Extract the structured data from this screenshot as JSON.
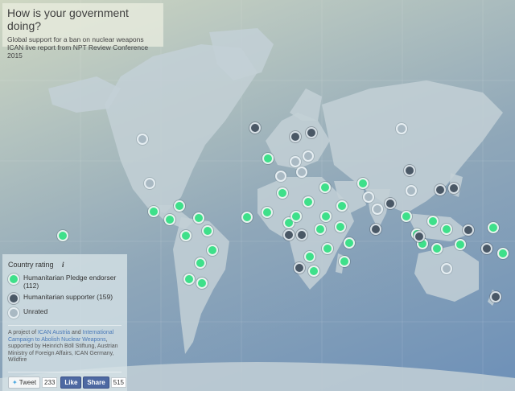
{
  "header": {
    "title": "How is your government doing?",
    "subtitle_line1": "Global support for a ban on nuclear weapons",
    "subtitle_line2": "ICAN live report from NPT Review Conference 2015"
  },
  "legend": {
    "title": "Country rating",
    "info_glyph": "i",
    "items": [
      {
        "label": "Humanitarian Pledge endorser (112)",
        "color": "#3ee08a"
      },
      {
        "label": "Humanitarian supporter (159)",
        "color": "#4a5866"
      },
      {
        "label": "Unrated",
        "color": "#a9b9c3"
      }
    ]
  },
  "credit": {
    "prefix": "A project of",
    "org1": "ICAN Austria",
    "and": "and",
    "org2": "International Campaign to Abolish Nuclear Weapons",
    "suffix": ", supported by Heinrich Böll Stiftung, Austrian Ministry of Foreign Affairs, ICAN Germany, Wildfire"
  },
  "share": {
    "tweet_label": "Tweet",
    "tweet_count": "233",
    "like_label": "Like",
    "share_label": "Share",
    "fb_count": "515"
  },
  "colors": {
    "endorser": "#3ee08a",
    "supporter": "#4a5866",
    "unrated": "#a9b9c3"
  }
}
